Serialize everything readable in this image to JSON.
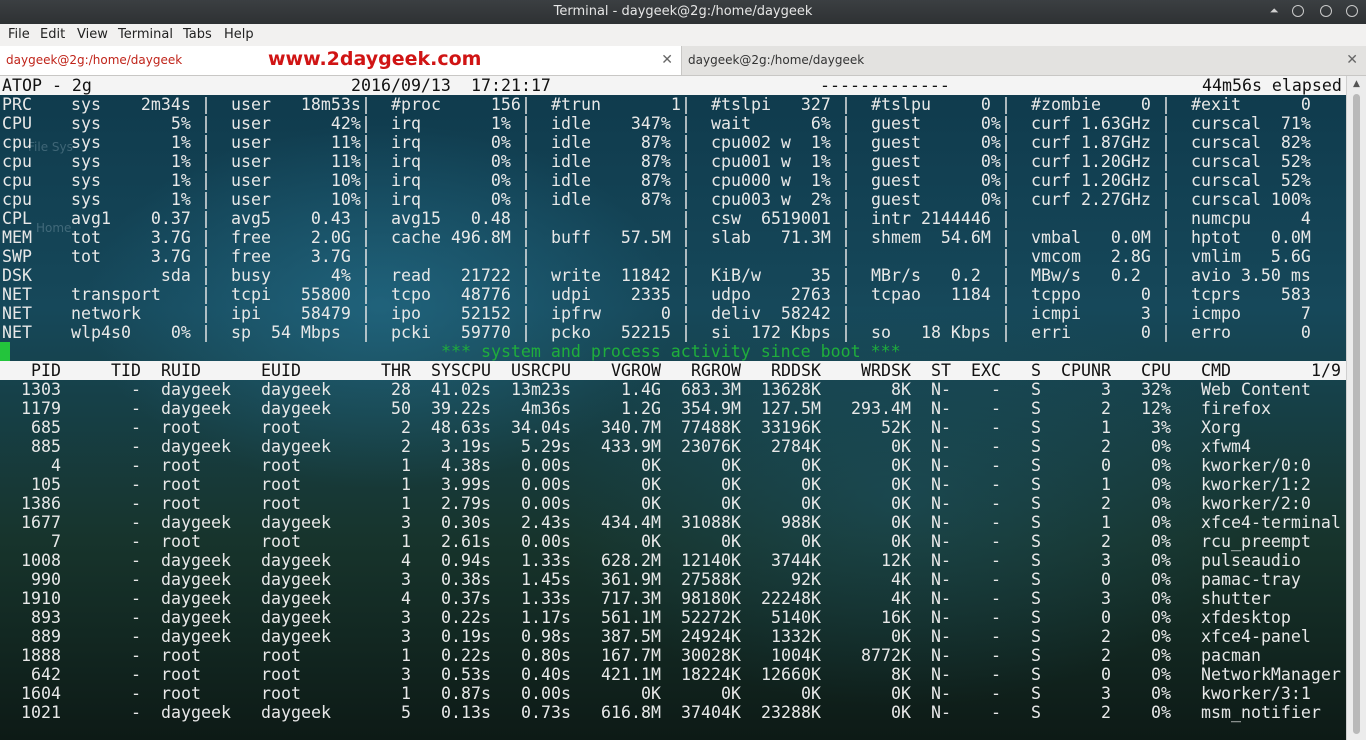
{
  "window": {
    "title": "Terminal - daygeek@2g:/home/daygeek"
  },
  "menu": [
    "File",
    "Edit",
    "View",
    "Terminal",
    "Tabs",
    "Help"
  ],
  "tabs": [
    {
      "label": "daygeek@2g:/home/daygeek"
    },
    {
      "label": "daygeek@2g:/home/daygeek"
    }
  ],
  "watermark": "www.2daygeek.com",
  "desktop_ghost": [
    "File Sys",
    "Home"
  ],
  "atop": {
    "header": {
      "name": "ATOP - 2g",
      "date": "2016/09/13",
      "time": "17:21:17",
      "dashes": "-------------",
      "elapsed": "44m56s elapsed"
    },
    "system_rows": [
      [
        "PRC",
        "sys    2m34s",
        "user   18m53s",
        "#proc     156",
        "#trun       1",
        "#tslpi   327",
        "#tslpu     0",
        "#zombie    0",
        "#exit      0"
      ],
      [
        "CPU",
        "sys       5%",
        "user      42%",
        "irq       1%",
        "idle    347%",
        "wait      6%",
        "guest      0%",
        "curf 1.63GHz",
        "curscal  71%"
      ],
      [
        "cpu",
        "sys       1%",
        "user      11%",
        "irq       0%",
        "idle     87%",
        "cpu002 w  1%",
        "guest      0%",
        "curf 1.87GHz",
        "curscal  82%"
      ],
      [
        "cpu",
        "sys       1%",
        "user      11%",
        "irq       0%",
        "idle     87%",
        "cpu001 w  1%",
        "guest      0%",
        "curf 1.20GHz",
        "curscal  52%"
      ],
      [
        "cpu",
        "sys       1%",
        "user      10%",
        "irq       0%",
        "idle     87%",
        "cpu000 w  1%",
        "guest      0%",
        "curf 1.20GHz",
        "curscal  52%"
      ],
      [
        "cpu",
        "sys       1%",
        "user      10%",
        "irq       0%",
        "idle     87%",
        "cpu003 w  2%",
        "guest      0%",
        "curf 2.27GHz",
        "curscal 100%"
      ],
      [
        "CPL",
        "avg1    0.37",
        "avg5    0.43",
        "avg15   0.48",
        "",
        "csw  6519001",
        "intr 2144446",
        "",
        "numcpu     4"
      ],
      [
        "MEM",
        "tot     3.7G",
        "free    2.0G",
        "cache 496.8M",
        "buff   57.5M",
        "slab   71.3M",
        "shmem  54.6M",
        "vmbal   0.0M",
        "hptot   0.0M"
      ],
      [
        "SWP",
        "tot     3.7G",
        "free    3.7G",
        "",
        "",
        "",
        "",
        "vmcom   2.8G",
        "vmlim   5.6G"
      ],
      [
        "DSK",
        "         sda",
        "busy      4%",
        "read   21722",
        "write  11842",
        "KiB/w     35",
        "MBr/s   0.2",
        "MBw/s   0.2",
        "avio 3.50 ms"
      ],
      [
        "NET",
        "transport",
        "tcpi   55800",
        "tcpo   48776",
        "udpi    2335",
        "udpo    2763",
        "tcpao   1184",
        "tcppo      0",
        "tcprs    583"
      ],
      [
        "NET",
        "network",
        "ipi    58479",
        "ipo    52152",
        "ipfrw      0",
        "deliv  58242",
        "",
        "icmpi      3",
        "icmpo      7"
      ],
      [
        "NET",
        "wlp4s0    0%",
        "sp  54 Mbps",
        "pcki   59770",
        "pcko   52215",
        "si  172 Kbps",
        "so   18 Kbps",
        "erri       0",
        "erro       0"
      ]
    ],
    "separator": "*** system and process activity since boot ***",
    "proc_header": {
      "PID": "PID",
      "TID": "TID",
      "RUID": "RUID",
      "EUID": "EUID",
      "THR": "THR",
      "SYSCPU": "SYSCPU",
      "USRCPU": "USRCPU",
      "VGROW": "VGROW",
      "RGROW": "RGROW",
      "RDDSK": "RDDSK",
      "WRDSK": "WRDSK",
      "ST": "ST",
      "EXC": "EXC",
      "S": "S",
      "CPUNR": "CPUNR",
      "CPU": "CPU",
      "CMD": "CMD",
      "page": "1/9"
    },
    "processes": [
      [
        "1303",
        "-",
        "daygeek",
        "daygeek",
        "28",
        "41.02s",
        "13m23s",
        "1.4G",
        "683.3M",
        "13628K",
        "8K",
        "N-",
        "-",
        "S",
        "3",
        "32%",
        "Web Content"
      ],
      [
        "1179",
        "-",
        "daygeek",
        "daygeek",
        "50",
        "39.22s",
        "4m36s",
        "1.2G",
        "354.9M",
        "127.5M",
        "293.4M",
        "N-",
        "-",
        "S",
        "2",
        "12%",
        "firefox"
      ],
      [
        "685",
        "-",
        "root",
        "root",
        "2",
        "48.63s",
        "34.04s",
        "340.7M",
        "77488K",
        "33196K",
        "52K",
        "N-",
        "-",
        "S",
        "1",
        "3%",
        "Xorg"
      ],
      [
        "885",
        "-",
        "daygeek",
        "daygeek",
        "2",
        "3.19s",
        "5.29s",
        "433.9M",
        "23076K",
        "2784K",
        "0K",
        "N-",
        "-",
        "S",
        "2",
        "0%",
        "xfwm4"
      ],
      [
        "4",
        "-",
        "root",
        "root",
        "1",
        "4.38s",
        "0.00s",
        "0K",
        "0K",
        "0K",
        "0K",
        "N-",
        "-",
        "S",
        "0",
        "0%",
        "kworker/0:0"
      ],
      [
        "105",
        "-",
        "root",
        "root",
        "1",
        "3.99s",
        "0.00s",
        "0K",
        "0K",
        "0K",
        "0K",
        "N-",
        "-",
        "S",
        "1",
        "0%",
        "kworker/1:2"
      ],
      [
        "1386",
        "-",
        "root",
        "root",
        "1",
        "2.79s",
        "0.00s",
        "0K",
        "0K",
        "0K",
        "0K",
        "N-",
        "-",
        "S",
        "2",
        "0%",
        "kworker/2:0"
      ],
      [
        "1677",
        "-",
        "daygeek",
        "daygeek",
        "3",
        "0.30s",
        "2.43s",
        "434.4M",
        "31088K",
        "988K",
        "0K",
        "N-",
        "-",
        "S",
        "1",
        "0%",
        "xfce4-terminal"
      ],
      [
        "7",
        "-",
        "root",
        "root",
        "1",
        "2.61s",
        "0.00s",
        "0K",
        "0K",
        "0K",
        "0K",
        "N-",
        "-",
        "S",
        "2",
        "0%",
        "rcu_preempt"
      ],
      [
        "1008",
        "-",
        "daygeek",
        "daygeek",
        "4",
        "0.94s",
        "1.33s",
        "628.2M",
        "12140K",
        "3744K",
        "12K",
        "N-",
        "-",
        "S",
        "3",
        "0%",
        "pulseaudio"
      ],
      [
        "990",
        "-",
        "daygeek",
        "daygeek",
        "3",
        "0.38s",
        "1.45s",
        "361.9M",
        "27588K",
        "92K",
        "4K",
        "N-",
        "-",
        "S",
        "0",
        "0%",
        "pamac-tray"
      ],
      [
        "1910",
        "-",
        "daygeek",
        "daygeek",
        "4",
        "0.37s",
        "1.33s",
        "717.3M",
        "98180K",
        "22248K",
        "4K",
        "N-",
        "-",
        "S",
        "3",
        "0%",
        "shutter"
      ],
      [
        "893",
        "-",
        "daygeek",
        "daygeek",
        "3",
        "0.22s",
        "1.17s",
        "561.1M",
        "52272K",
        "5140K",
        "16K",
        "N-",
        "-",
        "S",
        "0",
        "0%",
        "xfdesktop"
      ],
      [
        "889",
        "-",
        "daygeek",
        "daygeek",
        "3",
        "0.19s",
        "0.98s",
        "387.5M",
        "24924K",
        "1332K",
        "0K",
        "N-",
        "-",
        "S",
        "2",
        "0%",
        "xfce4-panel"
      ],
      [
        "1888",
        "-",
        "root",
        "root",
        "1",
        "0.22s",
        "0.80s",
        "167.7M",
        "30028K",
        "1004K",
        "8772K",
        "N-",
        "-",
        "S",
        "2",
        "0%",
        "pacman"
      ],
      [
        "642",
        "-",
        "root",
        "root",
        "3",
        "0.53s",
        "0.40s",
        "421.1M",
        "18224K",
        "12660K",
        "8K",
        "N-",
        "-",
        "S",
        "0",
        "0%",
        "NetworkManager"
      ],
      [
        "1604",
        "-",
        "root",
        "root",
        "1",
        "0.87s",
        "0.00s",
        "0K",
        "0K",
        "0K",
        "0K",
        "N-",
        "-",
        "S",
        "3",
        "0%",
        "kworker/3:1"
      ],
      [
        "1021",
        "-",
        "daygeek",
        "daygeek",
        "5",
        "0.13s",
        "0.73s",
        "616.8M",
        "37404K",
        "23288K",
        "0K",
        "N-",
        "-",
        "S",
        "2",
        "0%",
        "msm_notifier"
      ]
    ]
  },
  "colors": {
    "separator": "#1fae3c",
    "active_tab_text": "#c0241a",
    "watermark": "#d01414"
  }
}
